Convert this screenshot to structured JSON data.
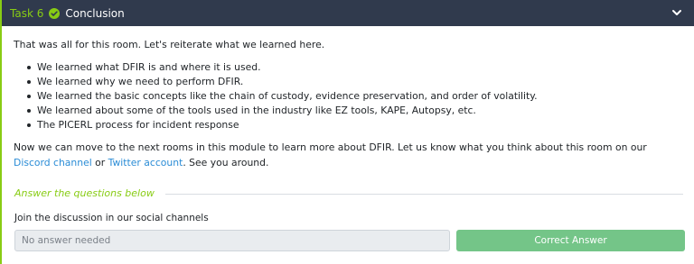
{
  "colors": {
    "header_bg": "#303a4d",
    "accent": "#88cc14",
    "link": "#2a8cd6",
    "success_button": "#74c588"
  },
  "task": {
    "number": "Task 6",
    "status_icon": "check-circle-icon",
    "title": "Conclusion",
    "collapse_icon": "chevron-down-icon"
  },
  "content": {
    "intro": "That was all for this room. Let's reiterate what we learned here.",
    "learned": [
      "We learned what DFIR is and where it is used.",
      "We learned why we need to perform DFIR.",
      "We learned the basic concepts like the chain of custody, evidence preservation, and order of volatility.",
      "We learned about some of the tools used in the industry like EZ tools, KAPE, Autopsy, etc.",
      "The PICERL process for incident response"
    ],
    "outro_before": "Now we can move to the next rooms in this module to learn more about DFIR. Let us know what you think about this room on our ",
    "discord_link": "Discord channel",
    "outro_middle": " or ",
    "twitter_link": "Twitter account",
    "outro_after": ". See you around."
  },
  "questions": {
    "section_title": "Answer the questions below",
    "items": [
      {
        "question": "Join the discussion in our social channels",
        "answer_value": "No answer needed",
        "button_label": "Correct Answer"
      }
    ]
  }
}
